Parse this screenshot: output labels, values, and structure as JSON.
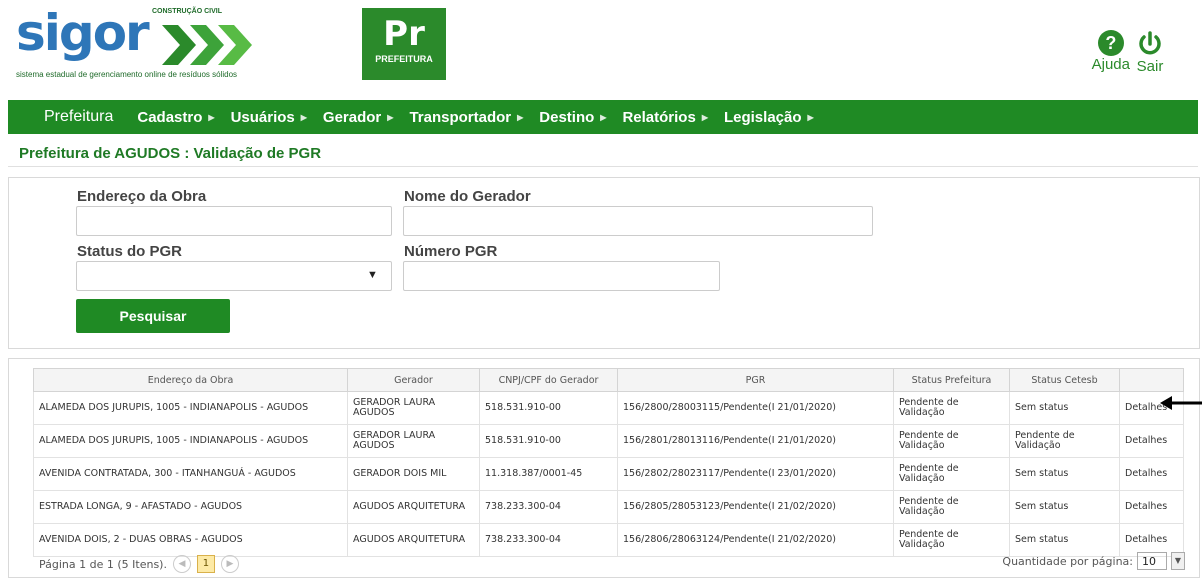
{
  "header": {
    "logo_word": "sigor",
    "logo_tagline": "CONSTRUÇÃO CIVIL",
    "logo_subtitle": "sistema estadual de gerenciamento online de resíduos sólidos",
    "badge_big": "Pr",
    "badge_small": "PREFEITURA",
    "help_label": "Ajuda",
    "exit_label": "Sair",
    "accent_color": "#1f8a24"
  },
  "nav": {
    "home": "Prefeitura",
    "items": [
      "Cadastro",
      "Usuários",
      "Gerador",
      "Transportador",
      "Destino",
      "Relatórios",
      "Legislação"
    ]
  },
  "page": {
    "title": "Prefeitura de AGUDOS : Validação de PGR"
  },
  "search": {
    "endereco_label": "Endereço da Obra",
    "endereco_value": "",
    "gerador_label": "Nome do Gerador",
    "gerador_value": "",
    "status_label": "Status do PGR",
    "status_value": "",
    "numero_label": "Número PGR",
    "numero_value": "",
    "button_label": "Pesquisar"
  },
  "table": {
    "headers": [
      "Endereço da Obra",
      "Gerador",
      "CNPJ/CPF do Gerador",
      "PGR",
      "Status Prefeitura",
      "Status Cetesb",
      ""
    ],
    "rows": [
      [
        "ALAMEDA DOS JURUPIS, 1005 - INDIANAPOLIS - AGUDOS",
        "GERADOR LAURA AGUDOS",
        "518.531.910-00",
        "156/2800/28003115/Pendente(I 21/01/2020)",
        "Pendente de Validação",
        "Sem status",
        "Detalhes"
      ],
      [
        "ALAMEDA DOS JURUPIS, 1005 - INDIANAPOLIS - AGUDOS",
        "GERADOR LAURA AGUDOS",
        "518.531.910-00",
        "156/2801/28013116/Pendente(I 21/01/2020)",
        "Pendente de Validação",
        "Pendente de Validação",
        "Detalhes"
      ],
      [
        "AVENIDA CONTRATADA, 300 - ITANHANGUÁ - AGUDOS",
        "GERADOR DOIS MIL",
        "11.318.387/0001-45",
        "156/2802/28023117/Pendente(I 23/01/2020)",
        "Pendente de Validação",
        "Sem status",
        "Detalhes"
      ],
      [
        "ESTRADA LONGA, 9 - AFASTADO - AGUDOS",
        "AGUDOS ARQUITETURA",
        "738.233.300-04",
        "156/2805/28053123/Pendente(I 21/02/2020)",
        "Pendente de Validação",
        "Sem status",
        "Detalhes"
      ],
      [
        "AVENIDA DOIS, 2 - DUAS OBRAS - AGUDOS",
        "AGUDOS ARQUITETURA",
        "738.233.300-04",
        "156/2806/28063124/Pendente(I 21/02/2020)",
        "Pendente de Validação",
        "Sem status",
        "Detalhes"
      ]
    ]
  },
  "pager": {
    "summary": "Página 1 de 1 (5 Itens).",
    "current_page": "1",
    "page_size_label": "Quantidade por página:",
    "page_size": "10"
  }
}
